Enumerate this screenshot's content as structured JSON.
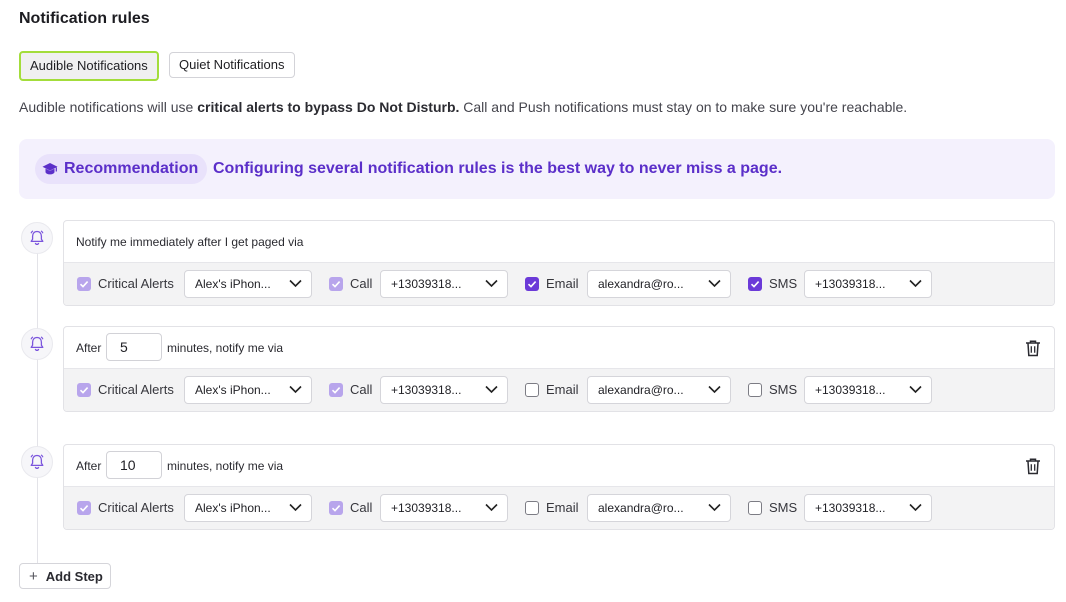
{
  "page": {
    "title": "Notification rules"
  },
  "tabs": [
    {
      "label": "Audible Notifications",
      "active": true
    },
    {
      "label": "Quiet Notifications",
      "active": false
    }
  ],
  "description": {
    "part1": "Audible notifications will use ",
    "bold": "critical alerts to bypass Do Not Disturb.",
    "part2": " Call and Push notifications must stay on to make sure you're reachable."
  },
  "recommendation": {
    "label": "Recommendation",
    "text": "Configuring several notification rules is the best way to never miss a page.",
    "icon": "graduation-cap-icon"
  },
  "colors": {
    "accent": "#5b2fc9",
    "highlight": "#a3dd3b",
    "checkbox_on": "#6b3ad8",
    "checkbox_disabled": "#b8a5ec"
  },
  "steps": [
    {
      "text": "Notify me immediately after I get paged via",
      "channels": [
        {
          "label": "Critical Alerts",
          "checked": true,
          "disabled": true,
          "value": "Alex's iPhon..."
        },
        {
          "label": "Call",
          "checked": true,
          "disabled": true,
          "value": "+13039318..."
        },
        {
          "label": "Email",
          "checked": true,
          "disabled": false,
          "value": "alexandra@ro..."
        },
        {
          "label": "SMS",
          "checked": true,
          "disabled": false,
          "value": "+13039318..."
        }
      ]
    },
    {
      "prefix": "After",
      "delay": "5",
      "suffix": "minutes, notify me via",
      "channels": [
        {
          "label": "Critical Alerts",
          "checked": true,
          "disabled": true,
          "value": "Alex's iPhon..."
        },
        {
          "label": "Call",
          "checked": true,
          "disabled": true,
          "value": "+13039318..."
        },
        {
          "label": "Email",
          "checked": false,
          "disabled": false,
          "value": "alexandra@ro..."
        },
        {
          "label": "SMS",
          "checked": false,
          "disabled": false,
          "value": "+13039318..."
        }
      ]
    },
    {
      "prefix": "After",
      "delay": "10",
      "suffix": "minutes, notify me via",
      "channels": [
        {
          "label": "Critical Alerts",
          "checked": true,
          "disabled": true,
          "value": "Alex's iPhon..."
        },
        {
          "label": "Call",
          "checked": true,
          "disabled": true,
          "value": "+13039318..."
        },
        {
          "label": "Email",
          "checked": false,
          "disabled": false,
          "value": "alexandra@ro..."
        },
        {
          "label": "SMS",
          "checked": false,
          "disabled": false,
          "value": "+13039318..."
        }
      ]
    }
  ],
  "add_step": {
    "label": "Add Step"
  }
}
